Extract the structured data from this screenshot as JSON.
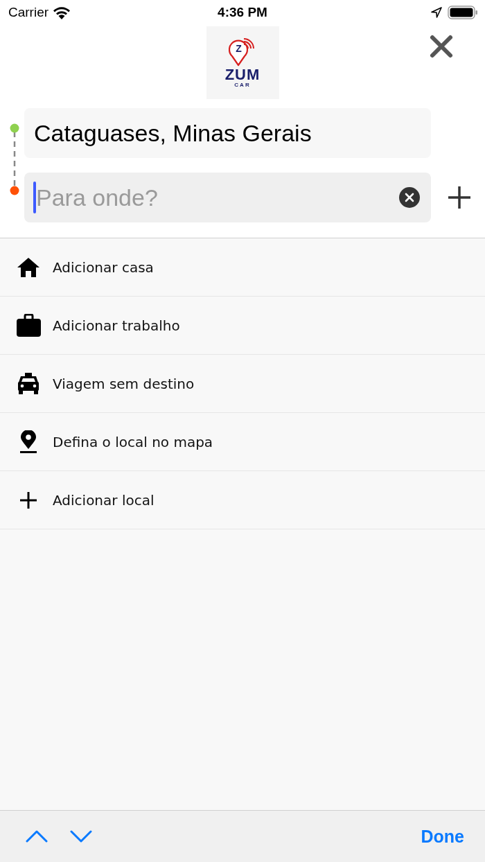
{
  "status_bar": {
    "carrier": "Carrier",
    "time": "4:36 PM"
  },
  "logo": {
    "badge": "Z",
    "name": "ZUM",
    "sub": "CAR"
  },
  "origin": {
    "value": "Cataguases, Minas Gerais"
  },
  "destination": {
    "placeholder": "Para onde?"
  },
  "items": [
    {
      "kind": "home",
      "label": "Adicionar casa"
    },
    {
      "kind": "work",
      "label": "Adicionar trabalho"
    },
    {
      "kind": "taxi",
      "label": "Viagem sem destino"
    },
    {
      "kind": "pin",
      "label": "Defina o local no mapa"
    },
    {
      "kind": "add",
      "label": "Adicionar local"
    }
  ],
  "keyboard_toolbar": {
    "done": "Done"
  }
}
